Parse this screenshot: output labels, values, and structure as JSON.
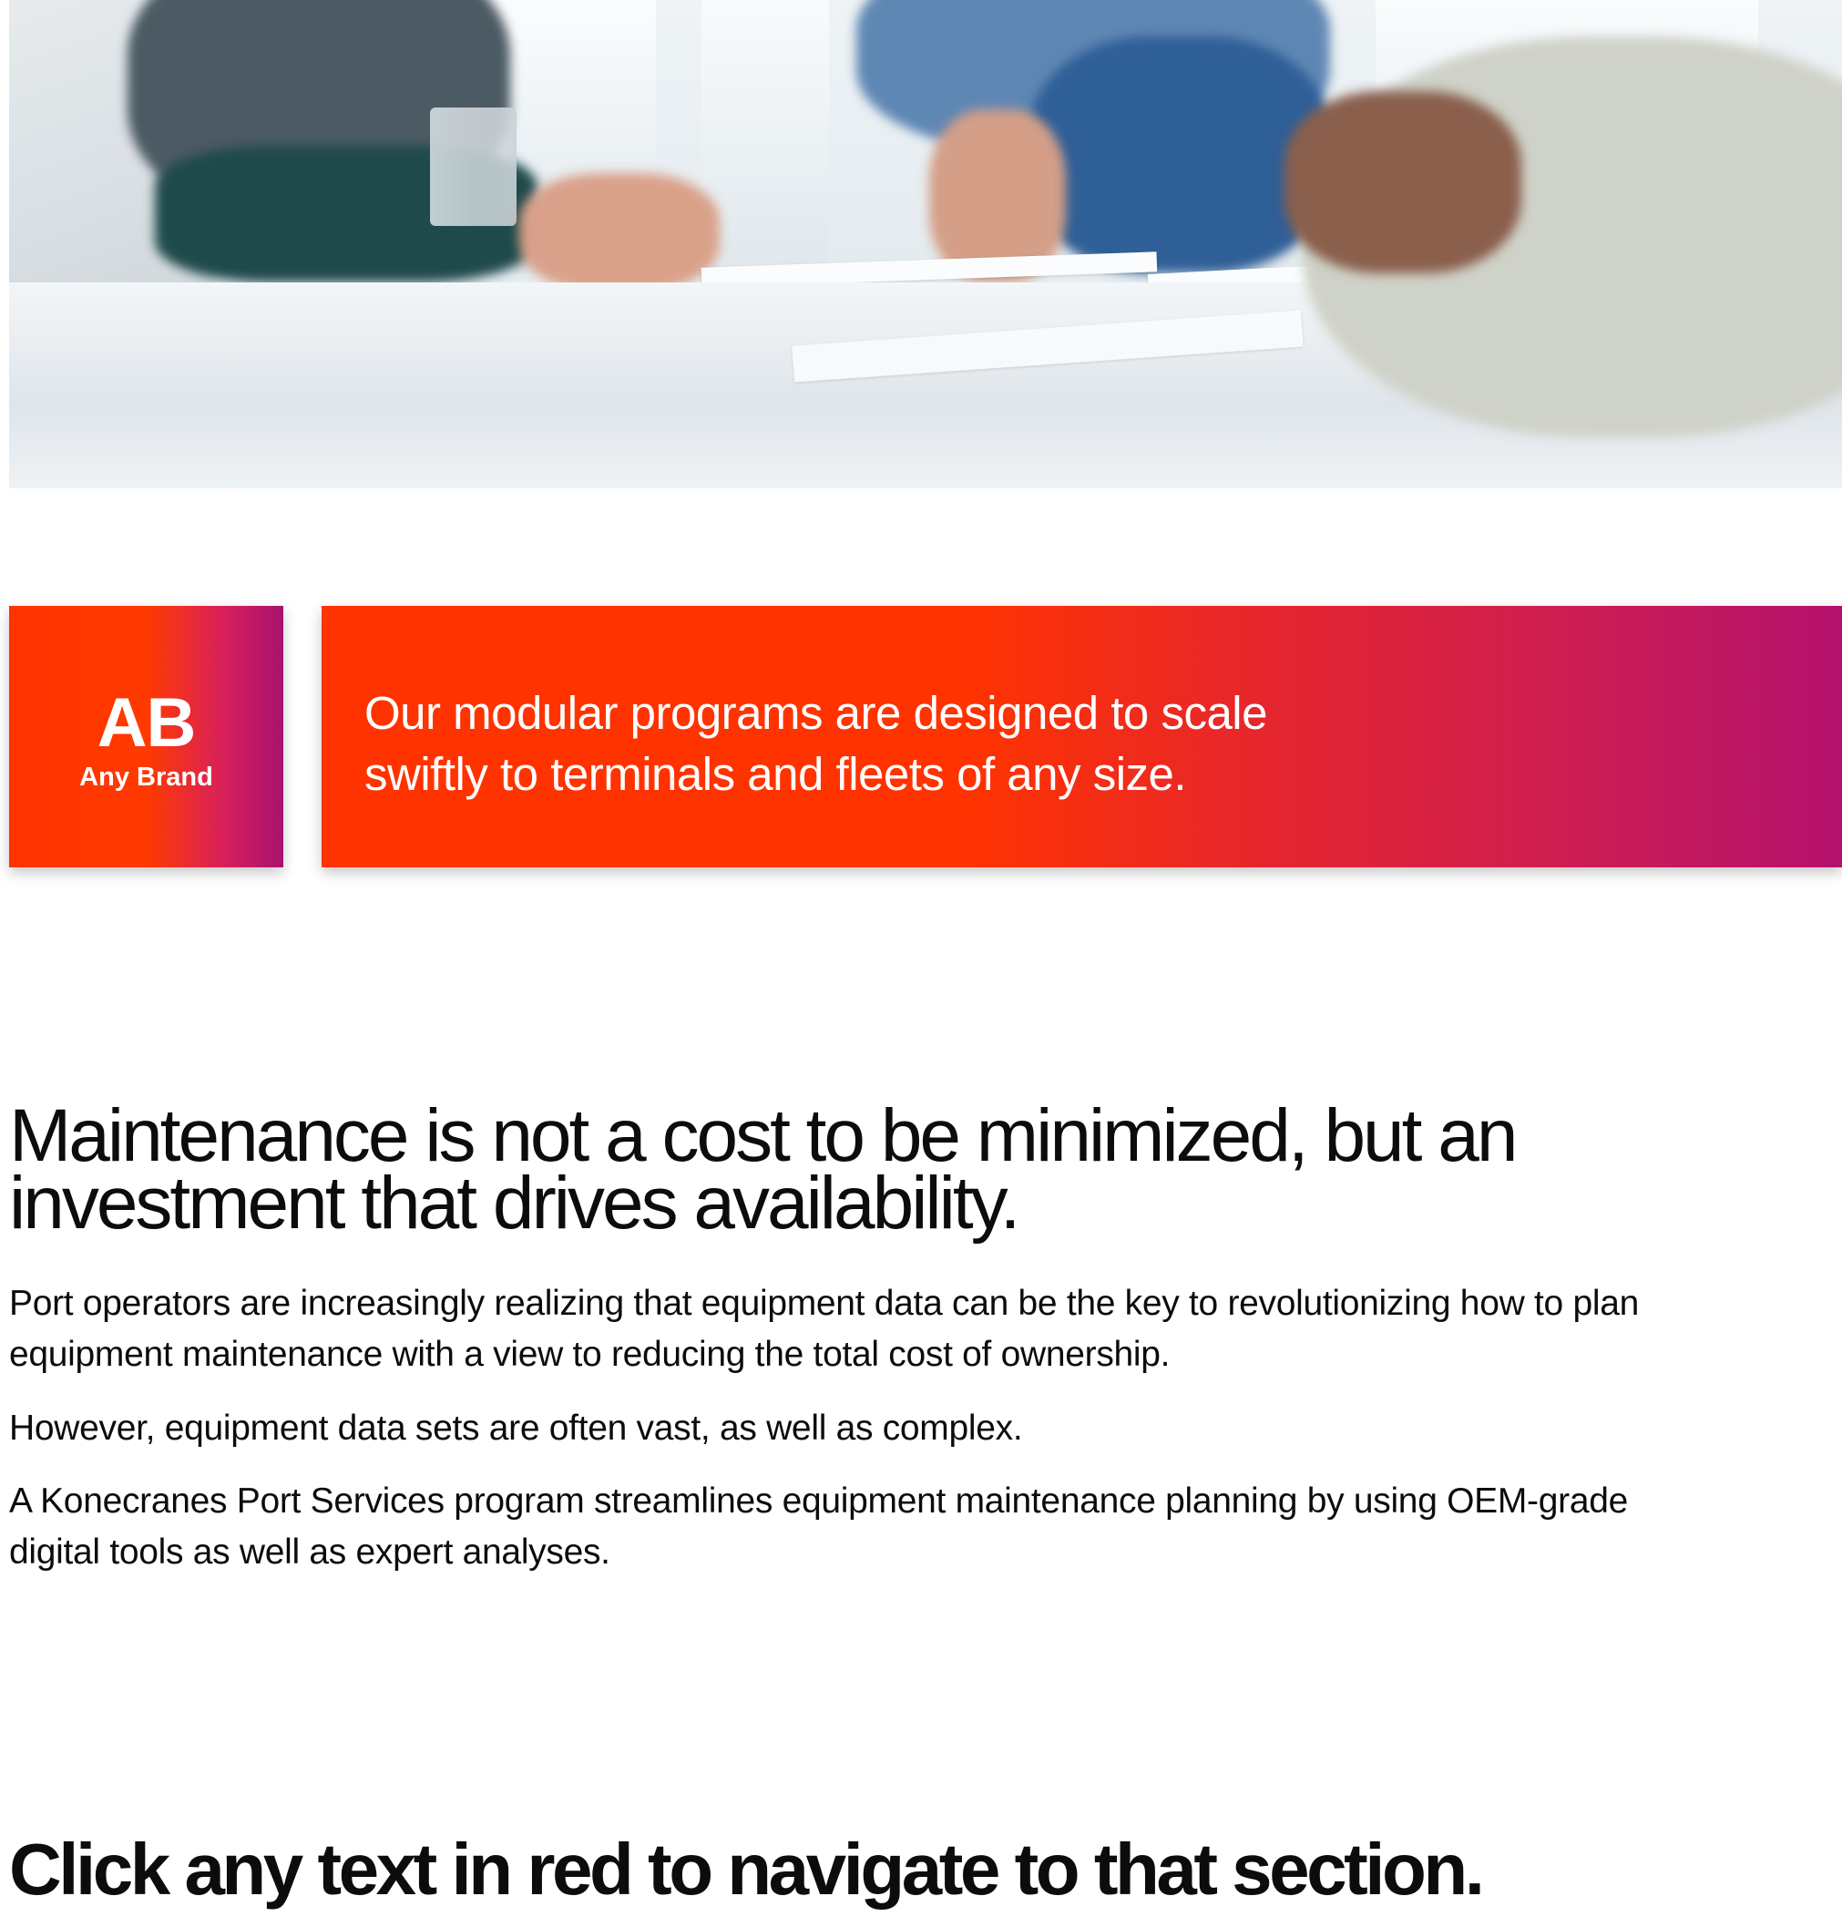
{
  "hero": {
    "image_alt": "Team meeting around a table"
  },
  "brand_badge": {
    "monogram": "AB",
    "name": "Any Brand"
  },
  "banner": {
    "text": "Our modular programs are designed to scale swiftly to terminals and fleets of any size."
  },
  "article": {
    "heading": "Maintenance is not a cost to be minimized, but an investment that drives availability.",
    "paragraphs": [
      "Port operators are increasingly realizing that equipment data can be the key to revolutionizing how to plan equipment maintenance with a view to reducing the total cost of ownership.",
      "However, equipment data sets are often vast, as well as complex.",
      "A Konecranes Port Services program streamlines equipment maintenance planning by using OEM-grade digital tools as well as expert analyses."
    ]
  },
  "cta": {
    "text": "Click any text in red to navigate to that section."
  },
  "colors": {
    "accent_red": "#ff3300",
    "accent_magenta": "#b5126f"
  }
}
